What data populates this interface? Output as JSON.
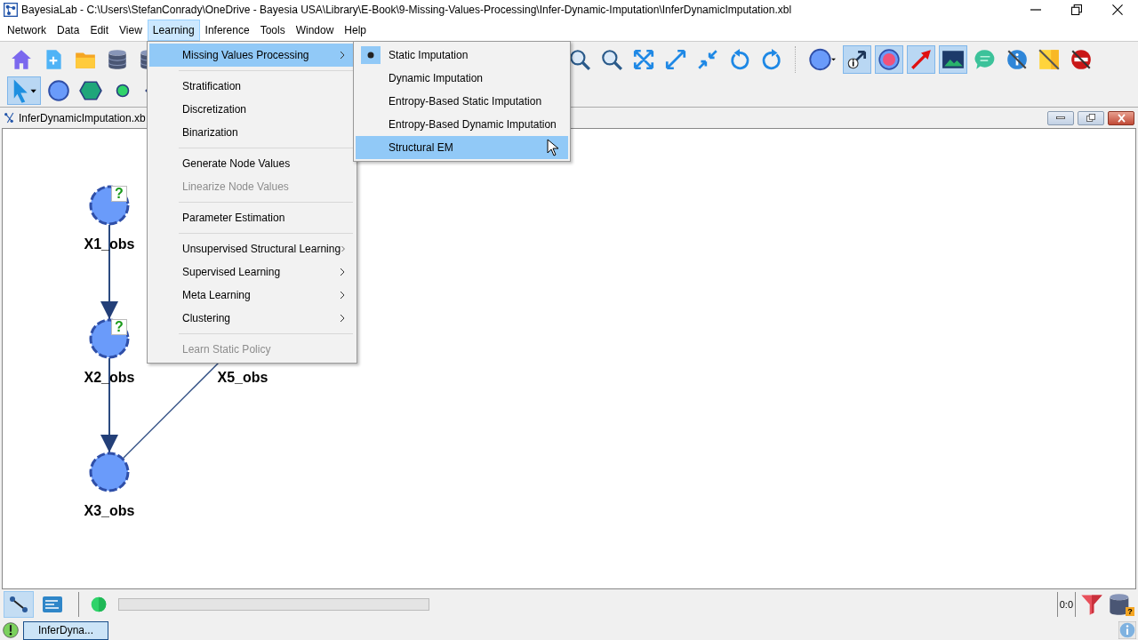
{
  "window": {
    "title": "BayesiaLab - C:\\Users\\StefanConrady\\OneDrive - Bayesia USA\\Library\\E-Book\\9-Missing-Values-Processing\\Infer-Dynamic-Imputation\\InferDynamicImputation.xbl"
  },
  "menubar": [
    {
      "label": "Network",
      "selected": false
    },
    {
      "label": "Data",
      "selected": false
    },
    {
      "label": "Edit",
      "selected": false
    },
    {
      "label": "View",
      "selected": false
    },
    {
      "label": "Learning",
      "selected": true
    },
    {
      "label": "Inference",
      "selected": false
    },
    {
      "label": "Tools",
      "selected": false
    },
    {
      "label": "Window",
      "selected": false
    },
    {
      "label": "Help",
      "selected": false
    }
  ],
  "toolbar_row_1_left": [
    {
      "kind": "home",
      "selected": false
    },
    {
      "kind": "new",
      "selected": false
    },
    {
      "kind": "folder",
      "selected": false
    },
    {
      "kind": "database",
      "selected": false
    },
    {
      "kind": "database",
      "selected": false
    }
  ],
  "toolbar_row_1_right": [
    {
      "kind": "zoom",
      "selected": false
    },
    {
      "kind": "zoom",
      "selected": false
    },
    {
      "kind": "fit",
      "selected": false
    },
    {
      "kind": "expand",
      "selected": false
    },
    {
      "kind": "shrink",
      "selected": false
    },
    {
      "kind": "undo",
      "selected": false
    },
    {
      "kind": "redo",
      "selected": false
    },
    {
      "kind": "separator"
    },
    {
      "kind": "node-dropdown",
      "selected": false
    },
    {
      "kind": "info-arrow",
      "selected": true
    },
    {
      "kind": "record",
      "selected": true
    },
    {
      "kind": "arrow",
      "selected": true
    },
    {
      "kind": "image",
      "selected": true
    },
    {
      "kind": "chat",
      "selected": false
    },
    {
      "kind": "info-off",
      "selected": false
    },
    {
      "kind": "note-off",
      "selected": false
    },
    {
      "kind": "no-entry",
      "selected": false
    }
  ],
  "toolbar_row_2": [
    {
      "kind": "pointer",
      "selected": true
    },
    {
      "kind": "circle",
      "selected": false
    },
    {
      "kind": "hexagon",
      "selected": false
    },
    {
      "kind": "small-circle",
      "selected": false
    },
    {
      "kind": "diamond",
      "selected": false
    }
  ],
  "document": {
    "title": "InferDynamicImputation.xb"
  },
  "nodes": [
    {
      "label": "X1_obs",
      "badge": "?"
    },
    {
      "label": "X2_obs",
      "badge": "?"
    },
    {
      "label": "X3_obs"
    },
    {
      "label": "X5_obs"
    }
  ],
  "learning_menu": [
    {
      "kind": "item",
      "label": "Missing Values Processing",
      "submenu": true,
      "selected": true,
      "disabled": false
    },
    {
      "kind": "separator"
    },
    {
      "kind": "item",
      "label": "Stratification",
      "submenu": false,
      "selected": false,
      "disabled": false
    },
    {
      "kind": "item",
      "label": "Discretization",
      "submenu": false,
      "selected": false,
      "disabled": false
    },
    {
      "kind": "item",
      "label": "Binarization",
      "submenu": false,
      "selected": false,
      "disabled": false
    },
    {
      "kind": "separator"
    },
    {
      "kind": "item",
      "label": "Generate Node Values",
      "submenu": false,
      "selected": false,
      "disabled": false
    },
    {
      "kind": "item",
      "label": "Linearize Node Values",
      "submenu": false,
      "selected": false,
      "disabled": true
    },
    {
      "kind": "separator"
    },
    {
      "kind": "item",
      "label": "Parameter Estimation",
      "submenu": false,
      "selected": false,
      "disabled": false
    },
    {
      "kind": "separator"
    },
    {
      "kind": "item",
      "label": "Unsupervised Structural Learning",
      "submenu": true,
      "selected": false,
      "disabled": false
    },
    {
      "kind": "item",
      "label": "Supervised Learning",
      "submenu": true,
      "selected": false,
      "disabled": false
    },
    {
      "kind": "item",
      "label": "Meta Learning",
      "submenu": true,
      "selected": false,
      "disabled": false
    },
    {
      "kind": "item",
      "label": "Clustering",
      "submenu": true,
      "selected": false,
      "disabled": false
    },
    {
      "kind": "separator"
    },
    {
      "kind": "item",
      "label": "Learn Static Policy",
      "submenu": false,
      "selected": false,
      "disabled": true
    }
  ],
  "missing_values_submenu": [
    {
      "label": "Static Imputation",
      "checked": true,
      "selected": false
    },
    {
      "label": "Dynamic Imputation",
      "checked": false,
      "selected": false
    },
    {
      "label": "Entropy-Based Static Imputation",
      "checked": false,
      "selected": false
    },
    {
      "label": "Entropy-Based Dynamic Imputation",
      "checked": false,
      "selected": false
    },
    {
      "label": "Structural EM",
      "checked": false,
      "selected": true
    }
  ],
  "status_bar": {
    "modes": [
      {
        "kind": "graph",
        "selected": true
      },
      {
        "kind": "text",
        "selected": false
      }
    ],
    "progress": {
      "level": 0
    },
    "counter": "0:0",
    "data_badge": "?"
  },
  "taskbar": {
    "windows": [
      {
        "label": "InferDyna...",
        "selected": true
      }
    ]
  }
}
